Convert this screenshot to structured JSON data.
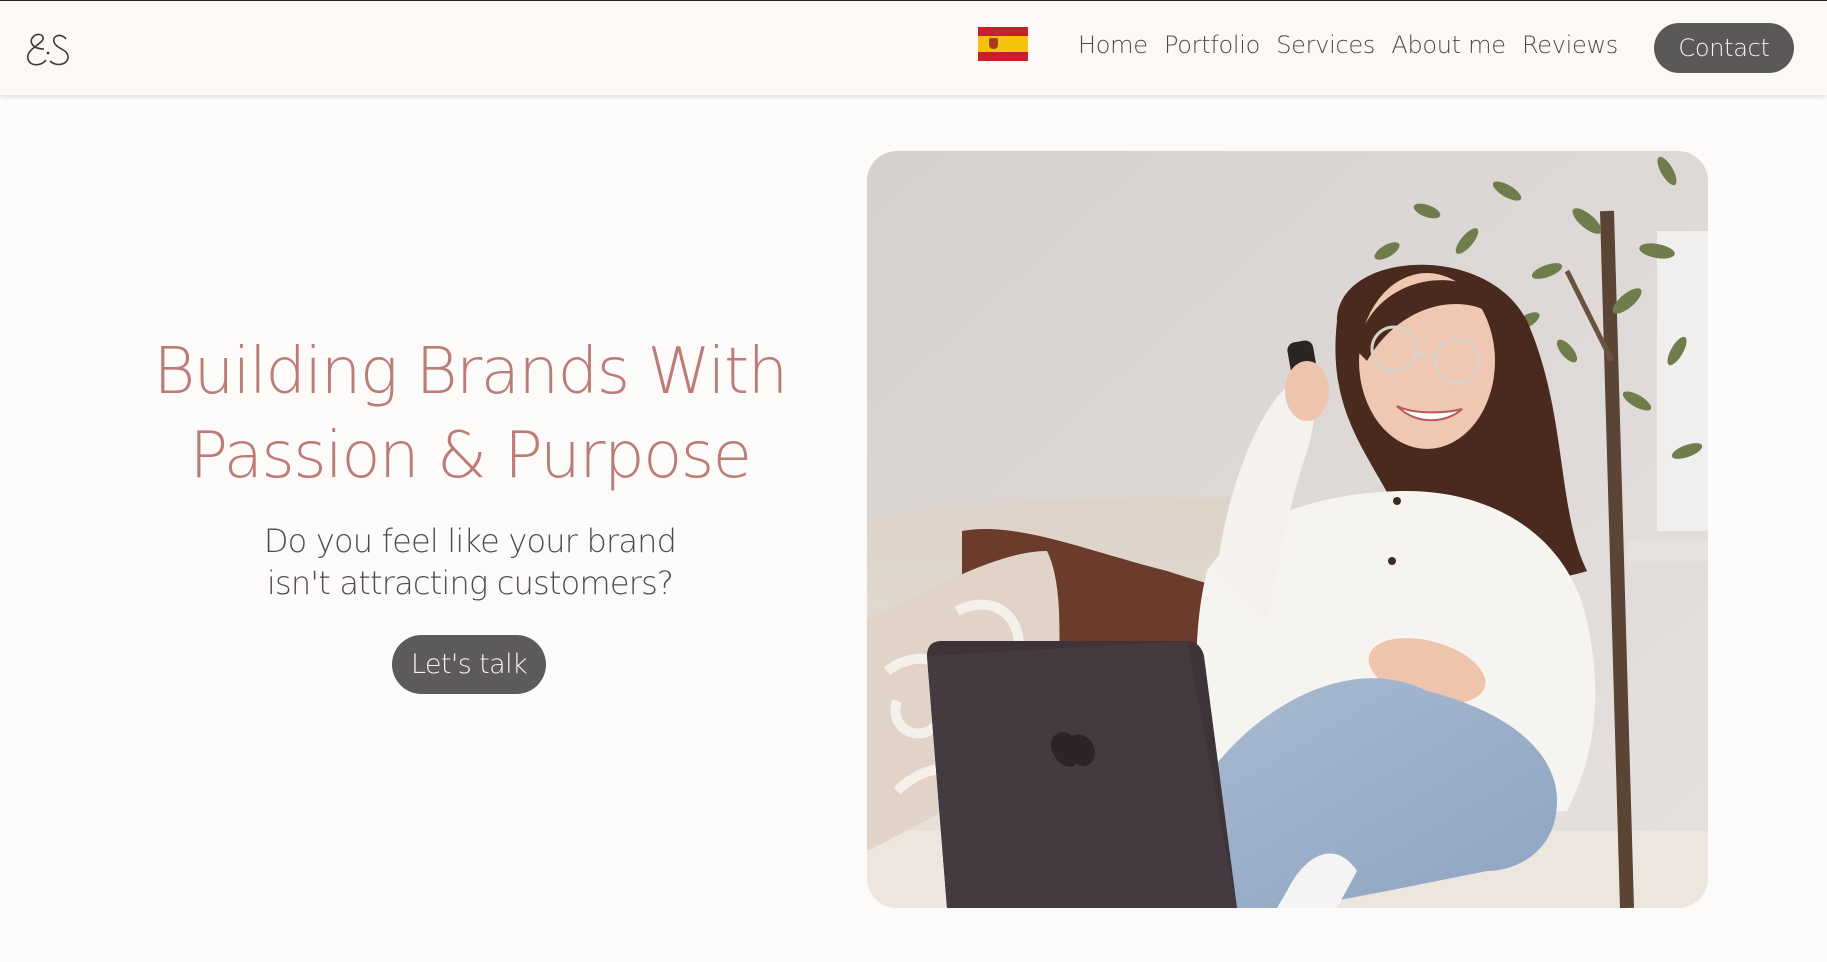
{
  "header": {
    "logo_icon": "es-monogram-logo",
    "language_flag": "spain-flag-icon",
    "nav": [
      "Home",
      "Portfolio",
      "Services",
      "About me",
      "Reviews"
    ],
    "contact_label": "Contact"
  },
  "hero": {
    "title_line1": "Building Brands With",
    "title_line2": "Passion & Purpose",
    "subtitle_line1": "Do you feel like your brand",
    "subtitle_line2": "isn't attracting customers?",
    "cta_label": "Let's talk",
    "photo": "woman-on-phone-with-laptop-photo"
  },
  "colors": {
    "background": "#fdfbfa",
    "header_bg": "#fbf8f6",
    "accent_rose": "#bd7b76",
    "button_gray": "#5a5858",
    "nav_text": "#4e4a4a"
  }
}
